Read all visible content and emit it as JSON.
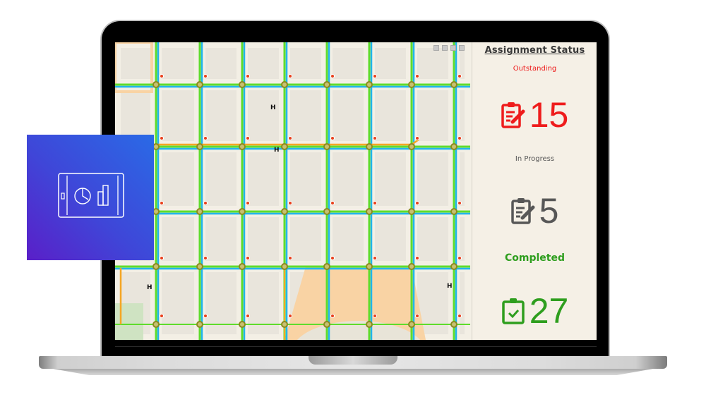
{
  "device": "laptop-mockup",
  "map": {
    "toolbar_icons": [
      "home-icon",
      "layers-icon",
      "legend-icon",
      "grid-icon"
    ]
  },
  "dashboard": {
    "title": "Assignment Status",
    "statuses": [
      {
        "label": "Outstanding",
        "count": "15",
        "color": "#ee1c1c",
        "icon": "clipboard-edit-icon"
      },
      {
        "label": "In Progress",
        "count": "5",
        "color": "#575757",
        "icon": "clipboard-edit-icon"
      },
      {
        "label": "Completed",
        "count": "27",
        "color": "#2e9e1e",
        "icon": "clipboard-check-icon"
      }
    ]
  },
  "overlay_card": {
    "icon": "tablet-analytics-icon",
    "accent_from": "#5a1fc8",
    "accent_to": "#2a6ae6"
  },
  "colors": {
    "street_blue": "#22b5ea",
    "street_green": "#5fdc2c",
    "route_orange": "#f5a623",
    "poi_red": "#e8401c",
    "node_olive": "#8a8a1e",
    "park_orange": "#f9d3a4"
  }
}
